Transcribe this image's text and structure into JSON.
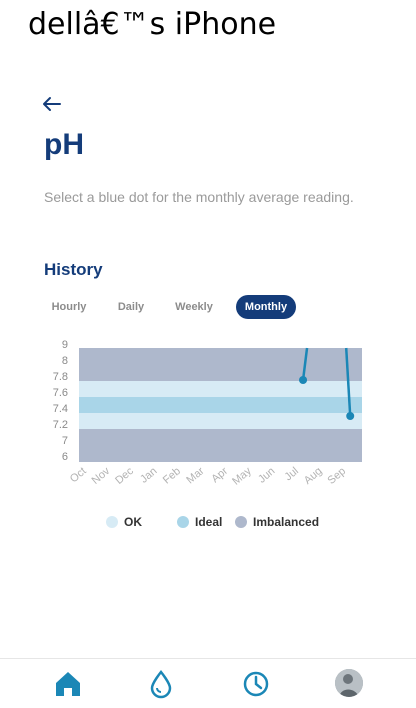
{
  "device": {
    "name": "dellâ€™s iPhone"
  },
  "header": {
    "title": "pH"
  },
  "instructions": "Select a blue dot for the monthly average reading.",
  "history": {
    "title": "History",
    "tabs": [
      {
        "label": "Hourly",
        "active": false
      },
      {
        "label": "Daily",
        "active": false
      },
      {
        "label": "Weekly",
        "active": false
      },
      {
        "label": "Monthly",
        "active": true
      }
    ]
  },
  "legend": [
    {
      "label": "OK",
      "color": "#d7ebf5"
    },
    {
      "label": "Ideal",
      "color": "#a9d5e8"
    },
    {
      "label": "Imbalanced",
      "color": "#aeb8cc"
    }
  ],
  "colors": {
    "accent": "#143c7a",
    "line": "#1b87b6"
  },
  "nav": {
    "items": [
      "home-icon",
      "water-drop-icon",
      "clock-icon",
      "avatar"
    ]
  },
  "chart_data": {
    "type": "line",
    "categories": [
      "Oct",
      "Nov",
      "Dec",
      "Jan",
      "Feb",
      "Mar",
      "Apr",
      "May",
      "Jun",
      "Jul",
      "Aug",
      "Sep"
    ],
    "yticks": [
      "9",
      "8",
      "7.8",
      "7.6",
      "7.4",
      "7.2",
      "7",
      "6"
    ],
    "ylim": [
      6,
      9
    ],
    "bands": [
      {
        "from": 7.8,
        "to": 9,
        "kind": "Imbalanced"
      },
      {
        "from": 7.6,
        "to": 7.8,
        "kind": "OK"
      },
      {
        "from": 7.4,
        "to": 7.6,
        "kind": "Ideal"
      },
      {
        "from": 7.2,
        "to": 7.4,
        "kind": "OK"
      },
      {
        "from": 6,
        "to": 7.2,
        "kind": "Imbalanced"
      }
    ],
    "series": [
      {
        "points": [
          {
            "x": "Jul",
            "y": 7.75
          },
          {
            "x": "Sep",
            "y": 7.3
          }
        ]
      }
    ]
  }
}
